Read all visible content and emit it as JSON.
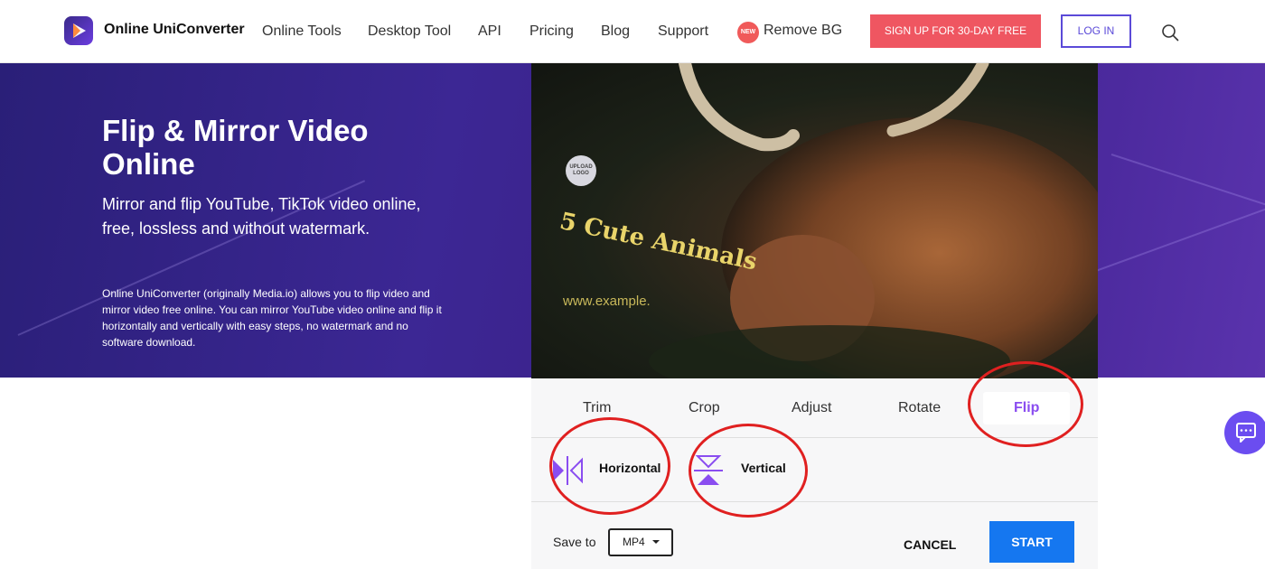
{
  "header": {
    "brand": "Online UniConverter",
    "nav": [
      "Online Tools",
      "Desktop Tool",
      "API",
      "Pricing",
      "Blog",
      "Support"
    ],
    "new_badge": "NEW",
    "remove_bg": "Remove BG",
    "signup": "SIGN UP FOR 30-DAY FREE",
    "login": "LOG IN"
  },
  "hero": {
    "title": "Flip & Mirror Video Online",
    "subtitle": "Mirror and flip YouTube, TikTok video online, free, lossless and without watermark.",
    "description": "Online UniConverter (originally Media.io) allows you to flip video and mirror video free online. You can mirror YouTube video online and flip it horizontally and vertically with easy steps, no watermark and no software download."
  },
  "video": {
    "upload_logo": "UPLOAD LOGO",
    "overlay_text": "5 Cute Animals",
    "url_text": "www.example."
  },
  "editor": {
    "tabs": [
      "Trim",
      "Crop",
      "Adjust",
      "Rotate",
      "Flip"
    ],
    "active_tab": "Flip",
    "flip_horizontal": "Horizontal",
    "flip_vertical": "Vertical",
    "save_to": "Save to",
    "format": "MP4",
    "cancel": "CANCEL",
    "start": "START"
  },
  "colors": {
    "accent": "#8a4df0",
    "signup": "#ef5661",
    "start": "#1577f0",
    "annotation": "#e02020"
  }
}
